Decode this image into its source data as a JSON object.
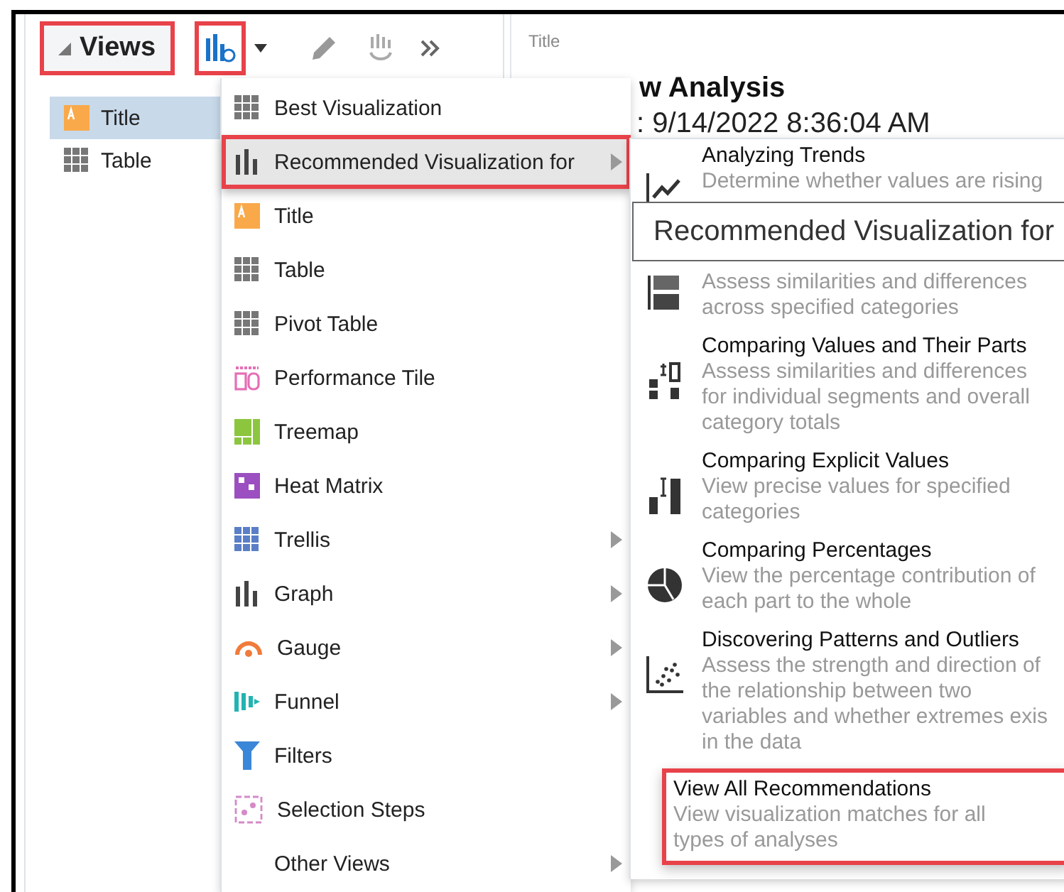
{
  "views_panel": {
    "title": "Views",
    "expanded": true,
    "marked": true,
    "items": [
      {
        "label": "Title",
        "selected": true
      },
      {
        "label": "Table",
        "selected": false
      }
    ]
  },
  "new_view_button": {
    "marked": true
  },
  "canvas": {
    "label": "Title",
    "heading": "w Analysis",
    "subheading": ": 9/14/2022 8:36:04 AM"
  },
  "menu": {
    "items": [
      {
        "label": "Best Visualization",
        "selected": false,
        "submenu": false,
        "marked": false
      },
      {
        "label": "Recommended Visualization for",
        "selected": true,
        "submenu": true,
        "marked": true
      },
      {
        "label": "Title",
        "selected": false,
        "submenu": false,
        "marked": false
      },
      {
        "label": "Table",
        "selected": false,
        "submenu": false,
        "marked": false
      },
      {
        "label": "Pivot Table",
        "selected": false,
        "submenu": false,
        "marked": false
      },
      {
        "label": "Performance Tile",
        "selected": false,
        "submenu": false,
        "marked": false
      },
      {
        "label": "Treemap",
        "selected": false,
        "submenu": false,
        "marked": false
      },
      {
        "label": "Heat Matrix",
        "selected": false,
        "submenu": false,
        "marked": false
      },
      {
        "label": "Trellis",
        "selected": false,
        "submenu": true,
        "marked": false
      },
      {
        "label": "Graph",
        "selected": false,
        "submenu": true,
        "marked": false
      },
      {
        "label": "Gauge",
        "selected": false,
        "submenu": true,
        "marked": false
      },
      {
        "label": "Funnel",
        "selected": false,
        "submenu": true,
        "marked": false
      },
      {
        "label": "Filters",
        "selected": false,
        "submenu": false,
        "marked": false
      },
      {
        "label": "Selection Steps",
        "selected": false,
        "submenu": false,
        "marked": false
      },
      {
        "label": "Other Views",
        "selected": false,
        "submenu": true,
        "marked": false
      }
    ]
  },
  "submenu": {
    "items": [
      {
        "kind": "recommendation",
        "title": "Analyzing Trends",
        "description": [
          "Determine whether values are rising"
        ],
        "marked": false
      },
      {
        "kind": "recommendation",
        "description": [
          "Assess similarities and differences",
          "across specified categories"
        ],
        "marked": false
      },
      {
        "kind": "recommendation",
        "title": "Comparing Values and Their Parts",
        "description": [
          "Assess similarities and differences",
          "for individual segments and overall",
          "category totals"
        ],
        "marked": false
      },
      {
        "kind": "recommendation",
        "title": "Comparing Explicit Values",
        "description": [
          "View precise values for specified",
          "categories"
        ],
        "marked": false
      },
      {
        "kind": "recommendation",
        "title": "Comparing Percentages",
        "description": [
          "View the percentage contribution of",
          "each part to the whole"
        ],
        "marked": false
      },
      {
        "kind": "recommendation",
        "title": "Discovering Patterns and Outliers",
        "description": [
          "Assess the strength and direction of",
          "the relationship between two",
          "variables and whether extremes exis",
          "in the data"
        ],
        "marked": false
      },
      {
        "kind": "view_all",
        "title": "View All Recommendations",
        "description": [
          "View visualization matches for all",
          "types of analyses"
        ],
        "marked": true
      }
    ]
  },
  "tooltip": {
    "text": "Recommended Visualization for"
  }
}
